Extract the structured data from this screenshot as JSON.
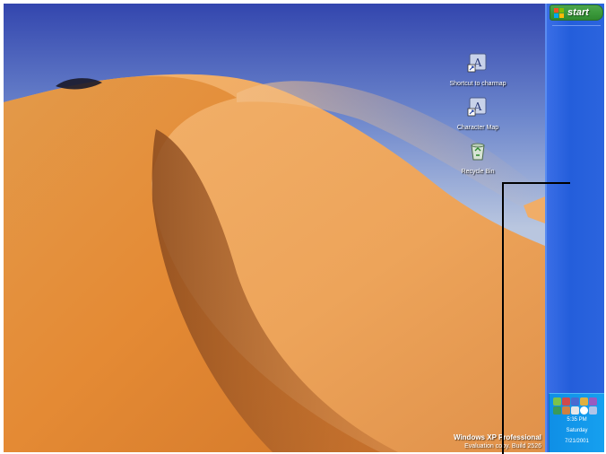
{
  "desktop": {
    "icons": [
      {
        "name": "shortcut-to-charmap",
        "label": "Shortcut to charmap"
      },
      {
        "name": "character-map",
        "label": "Character Map"
      },
      {
        "name": "recycle-bin",
        "label": "Recycle Bin"
      }
    ],
    "watermark": {
      "product": "Windows XP Professional",
      "evaluation": "Evaluation copy. Build 2526"
    }
  },
  "taskbar": {
    "start_label": "start",
    "tray_icons": [
      "tray-icon-1",
      "tray-icon-2",
      "tray-icon-3",
      "tray-icon-4",
      "tray-icon-5",
      "tray-icon-6",
      "tray-icon-7",
      "tray-icon-8",
      "tray-icon-9",
      "tray-icon-10"
    ],
    "clock": {
      "time": "5:35 PM",
      "day": "Saturday",
      "date": "7/21/2001"
    }
  },
  "colors": {
    "taskbar": "#245edb",
    "start_button": "#3c9a3c",
    "tray": "#0f8fe6",
    "sand": "#e8933a",
    "sky": "#3a4fb6"
  }
}
